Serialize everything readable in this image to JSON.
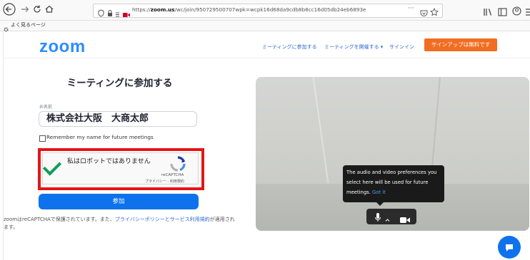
{
  "browser": {
    "url_prefix": "https://",
    "url_domain": "zoom.us",
    "url_rest": "/wc/join/950729500707wpk=wcpk16d68da9cdb8b8cc16d05db24eb6893e",
    "more_label": "···",
    "bookmark_label": "よく見るページ"
  },
  "header": {
    "logo": "zoom",
    "links": [
      "ミーティングに参加する",
      "ミーティングを開催する ▾",
      "サインイン"
    ],
    "signup": "サインアップは無料です"
  },
  "form": {
    "title": "ミーティングに参加する",
    "name_label": "お名前",
    "name_value": "株式会社大阪　大商太郎",
    "remember_label": "Remember my name for future meetings",
    "captcha_text": "私はロボットではありません",
    "captcha_brand": "reCAPTCHA",
    "captcha_terms": "プライバシー - 利用規約",
    "join_button": "参加",
    "notice_pre": "zoomはreCAPTCHAで保護されています。また、",
    "notice_link": "プライバシーポリシーとサービス利用規約",
    "notice_post": "が適用されます。"
  },
  "preview": {
    "tooltip_text": "The audio and video preferences you select here will be used for future meetings.",
    "gotit": "Got it"
  },
  "colors": {
    "accent": "#2d8cff",
    "signup_bg": "#f26d21",
    "join_bg": "#0e72ed",
    "highlight": "#e51515",
    "check": "#109d58"
  }
}
